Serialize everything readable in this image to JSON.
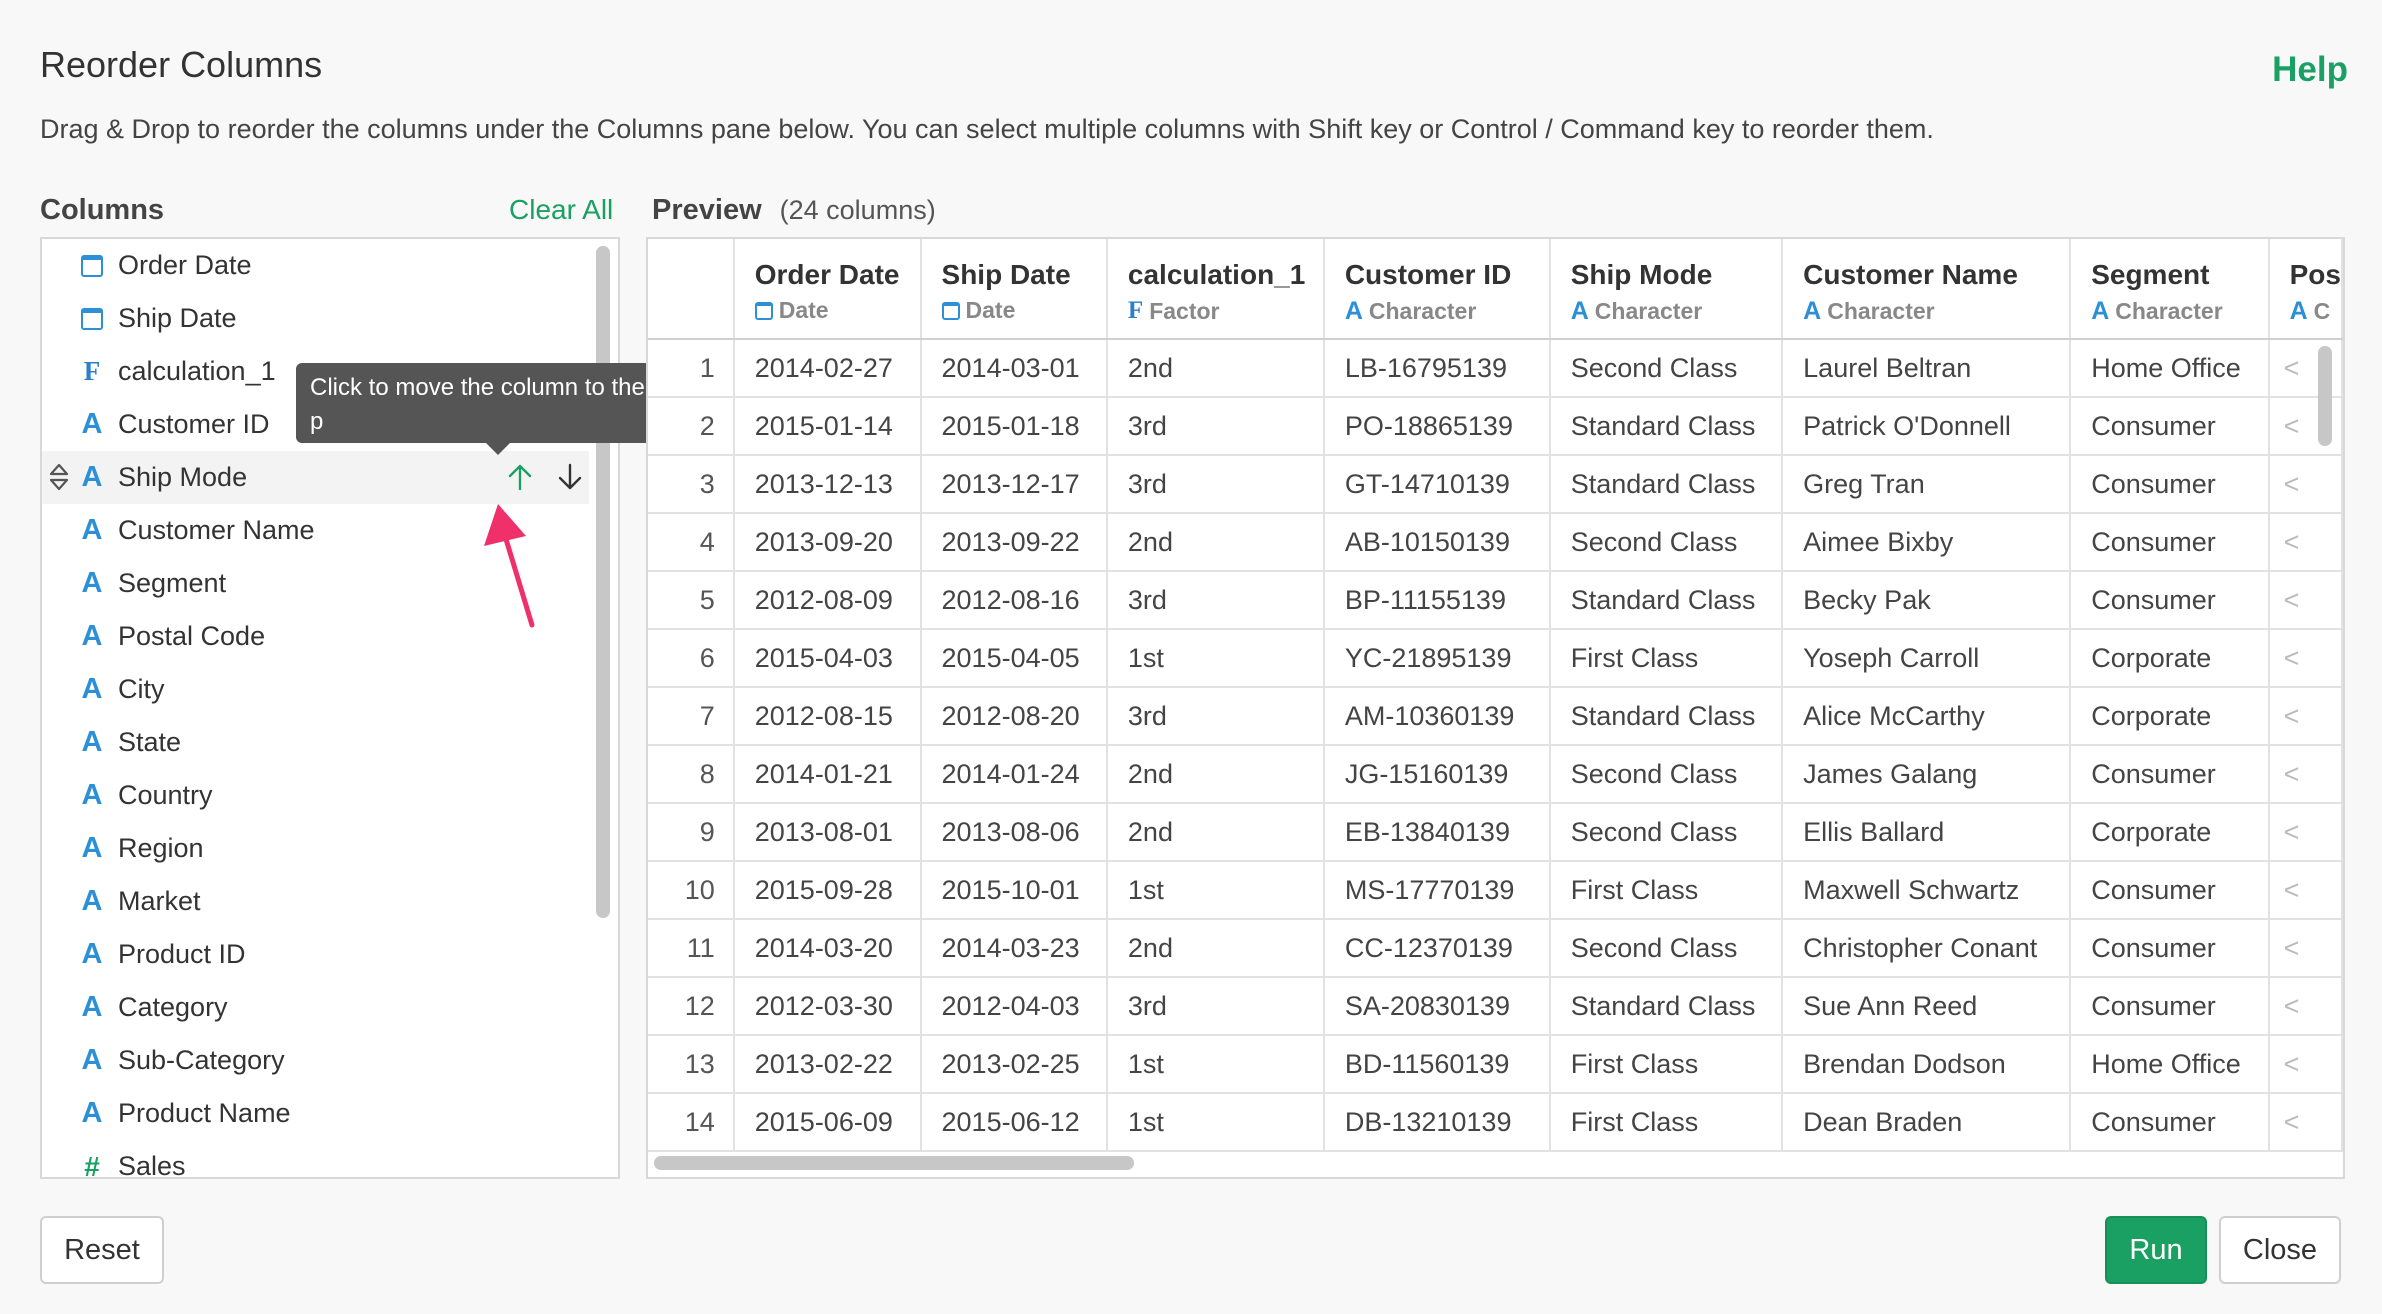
{
  "dialog": {
    "title": "Reorder Columns",
    "help": "Help",
    "description": "Drag & Drop to reorder the columns under the Columns pane below. You can select multiple columns with Shift key or Control / Command key to reorder them."
  },
  "columns_pane": {
    "header": "Columns",
    "clear_all": "Clear All",
    "items": [
      {
        "label": "Order Date",
        "icon": "calendar-icon"
      },
      {
        "label": "Ship Date",
        "icon": "calendar-icon"
      },
      {
        "label": "calculation_1",
        "icon": "factor-icon"
      },
      {
        "label": "Customer ID",
        "icon": "character-icon"
      },
      {
        "label": "Ship Mode",
        "icon": "character-icon"
      },
      {
        "label": "Customer Name",
        "icon": "character-icon"
      },
      {
        "label": "Segment",
        "icon": "character-icon"
      },
      {
        "label": "Postal Code",
        "icon": "character-icon"
      },
      {
        "label": "City",
        "icon": "character-icon"
      },
      {
        "label": "State",
        "icon": "character-icon"
      },
      {
        "label": "Country",
        "icon": "character-icon"
      },
      {
        "label": "Region",
        "icon": "character-icon"
      },
      {
        "label": "Market",
        "icon": "character-icon"
      },
      {
        "label": "Product ID",
        "icon": "character-icon"
      },
      {
        "label": "Category",
        "icon": "character-icon"
      },
      {
        "label": "Sub-Category",
        "icon": "character-icon"
      },
      {
        "label": "Product Name",
        "icon": "character-icon"
      },
      {
        "label": "Sales",
        "icon": "number-icon"
      }
    ],
    "tooltip": "Click to move the column to the top"
  },
  "preview": {
    "header": "Preview",
    "count": "(24 columns)",
    "columns": [
      {
        "name": "Order Date",
        "type": "Date",
        "icon": "calendar-icon"
      },
      {
        "name": "Ship Date",
        "type": "Date",
        "icon": "calendar-icon"
      },
      {
        "name": "calculation_1",
        "type": "Factor",
        "icon": "factor-icon"
      },
      {
        "name": "Customer ID",
        "type": "Character",
        "icon": "character-icon"
      },
      {
        "name": "Ship Mode",
        "type": "Character",
        "icon": "character-icon"
      },
      {
        "name": "Customer Name",
        "type": "Character",
        "icon": "character-icon"
      },
      {
        "name": "Segment",
        "type": "Character",
        "icon": "character-icon"
      },
      {
        "name": "Pos",
        "type": "C",
        "icon": "character-icon"
      }
    ],
    "rows": [
      [
        "1",
        "2014-02-27",
        "2014-03-01",
        "2nd",
        "LB-16795139",
        "Second Class",
        "Laurel Beltran",
        "Home Office",
        "<"
      ],
      [
        "2",
        "2015-01-14",
        "2015-01-18",
        "3rd",
        "PO-18865139",
        "Standard Class",
        "Patrick O'Donnell",
        "Consumer",
        "<"
      ],
      [
        "3",
        "2013-12-13",
        "2013-12-17",
        "3rd",
        "GT-14710139",
        "Standard Class",
        "Greg Tran",
        "Consumer",
        "<"
      ],
      [
        "4",
        "2013-09-20",
        "2013-09-22",
        "2nd",
        "AB-10150139",
        "Second Class",
        "Aimee Bixby",
        "Consumer",
        "<"
      ],
      [
        "5",
        "2012-08-09",
        "2012-08-16",
        "3rd",
        "BP-11155139",
        "Standard Class",
        "Becky Pak",
        "Consumer",
        "<"
      ],
      [
        "6",
        "2015-04-03",
        "2015-04-05",
        "1st",
        "YC-21895139",
        "First Class",
        "Yoseph Carroll",
        "Corporate",
        "<"
      ],
      [
        "7",
        "2012-08-15",
        "2012-08-20",
        "3rd",
        "AM-10360139",
        "Standard Class",
        "Alice McCarthy",
        "Corporate",
        "<"
      ],
      [
        "8",
        "2014-01-21",
        "2014-01-24",
        "2nd",
        "JG-15160139",
        "Second Class",
        "James Galang",
        "Consumer",
        "<"
      ],
      [
        "9",
        "2013-08-01",
        "2013-08-06",
        "2nd",
        "EB-13840139",
        "Second Class",
        "Ellis Ballard",
        "Corporate",
        "<"
      ],
      [
        "10",
        "2015-09-28",
        "2015-10-01",
        "1st",
        "MS-17770139",
        "First Class",
        "Maxwell Schwartz",
        "Consumer",
        "<"
      ],
      [
        "11",
        "2014-03-20",
        "2014-03-23",
        "2nd",
        "CC-12370139",
        "Second Class",
        "Christopher Conant",
        "Consumer",
        "<"
      ],
      [
        "12",
        "2012-03-30",
        "2012-04-03",
        "3rd",
        "SA-20830139",
        "Standard Class",
        "Sue Ann Reed",
        "Consumer",
        "<"
      ],
      [
        "13",
        "2013-02-22",
        "2013-02-25",
        "1st",
        "BD-11560139",
        "First Class",
        "Brendan Dodson",
        "Home Office",
        "<"
      ],
      [
        "14",
        "2015-06-09",
        "2015-06-12",
        "1st",
        "DB-13210139",
        "First Class",
        "Dean Braden",
        "Consumer",
        "<"
      ]
    ]
  },
  "footer": {
    "reset": "Reset",
    "run": "Run",
    "close": "Close"
  },
  "colors": {
    "accent": "#1aa063",
    "character_icon": "#2d8fd5",
    "annotation_arrow": "#f0306b"
  }
}
